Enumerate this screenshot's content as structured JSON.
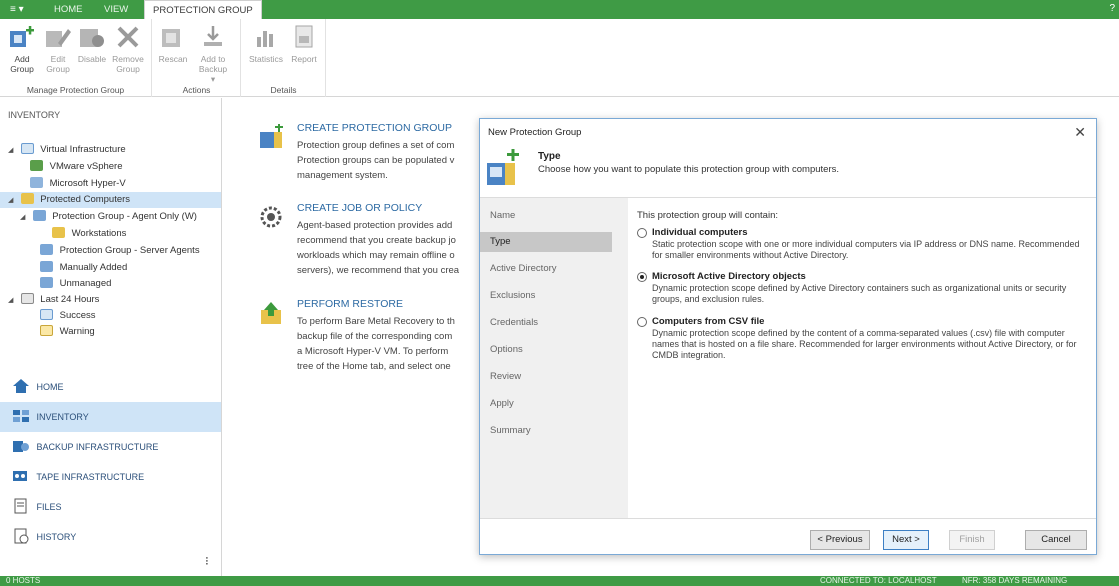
{
  "tabs": {
    "menu": "≡ ▾",
    "home": "HOME",
    "view": "VIEW",
    "protection_group": "PROTECTION GROUP",
    "help": "?"
  },
  "ribbon": {
    "manage": {
      "label": "Manage Protection Group",
      "add": "Add\nGroup",
      "edit": "Edit\nGroup",
      "disable": "Disable",
      "remove": "Remove\nGroup"
    },
    "actions": {
      "label": "Actions",
      "rescan": "Rescan",
      "add_to_backup": "Add to\nBackup ▾"
    },
    "details": {
      "label": "Details",
      "statistics": "Statistics",
      "report": "Report"
    }
  },
  "inventory": {
    "title": "INVENTORY",
    "tree": [
      {
        "label": "Virtual Infrastructure",
        "exp": "◢"
      },
      {
        "label": "VMware vSphere",
        "exp": ""
      },
      {
        "label": "Microsoft Hyper-V",
        "exp": ""
      },
      {
        "label": "Protected Computers",
        "exp": "◢"
      },
      {
        "label": "Protection Group - Agent Only (W)",
        "exp": "◢"
      },
      {
        "label": "Workstations",
        "exp": ""
      },
      {
        "label": "Protection Group - Server Agents",
        "exp": ""
      },
      {
        "label": "Manually Added",
        "exp": ""
      },
      {
        "label": "Unmanaged",
        "exp": ""
      },
      {
        "label": "Last 24 Hours",
        "exp": "◢"
      },
      {
        "label": "Success",
        "exp": ""
      },
      {
        "label": "Warning",
        "exp": ""
      }
    ]
  },
  "nav": {
    "home": "HOME",
    "inventory": "INVENTORY",
    "backup_infrastructure": "BACKUP INFRASTRUCTURE",
    "tape_infrastructure": "TAPE INFRASTRUCTURE",
    "files": "FILES",
    "history": "HISTORY",
    "more": "⁝"
  },
  "main": {
    "create_group": {
      "title": "CREATE PROTECTION GROUP",
      "text": [
        "Protection group defines a set of com",
        "Protection groups can be populated v",
        "management system."
      ]
    },
    "create_job": {
      "title": "CREATE JOB OR POLICY",
      "text": [
        "Agent-based protection provides add",
        "recommend that you create backup jo",
        "workloads which may remain offline o",
        "servers), we recommend that you crea"
      ]
    },
    "restore": {
      "title": "PERFORM RESTORE",
      "text": [
        "To perform Bare Metal Recovery to th",
        "backup file of the corresponding com",
        "a Microsoft Hyper-V VM. To perform",
        "tree of the Home tab, and select one"
      ]
    }
  },
  "dialog": {
    "title": "New Protection Group",
    "close": "✕",
    "header_title": "Type",
    "header_subtitle": "Choose how you want to populate this protection group with computers.",
    "steps": [
      "Name",
      "Type",
      "Active Directory",
      "Exclusions",
      "Credentials",
      "Options",
      "Review",
      "Apply",
      "Summary"
    ],
    "contain_label": "This protection group will contain:",
    "options": [
      {
        "title": "Individual computers",
        "desc": "Static protection scope with one or more individual computers via IP address or DNS name. Recommended for smaller environments without Active Directory.",
        "checked": false
      },
      {
        "title": "Microsoft Active Directory objects",
        "desc": "Dynamic protection scope defined by Active Directory containers such as organizational units or security groups, and exclusion rules.",
        "checked": true
      },
      {
        "title": "Computers from CSV file",
        "desc": "Dynamic protection scope defined by the content of a comma-separated values (.csv) file with computer names that is hosted on a file share. Recommended for larger environments without Active Directory, or for CMDB integration.",
        "checked": false
      }
    ],
    "buttons": {
      "previous": "< Previous",
      "next": "Next >",
      "finish": "Finish",
      "cancel": "Cancel"
    }
  },
  "status": {
    "left": "0 HOSTS",
    "connected": "CONNECTED TO: LOCALHOST",
    "license": "NFR: 358 DAYS REMAINING"
  }
}
